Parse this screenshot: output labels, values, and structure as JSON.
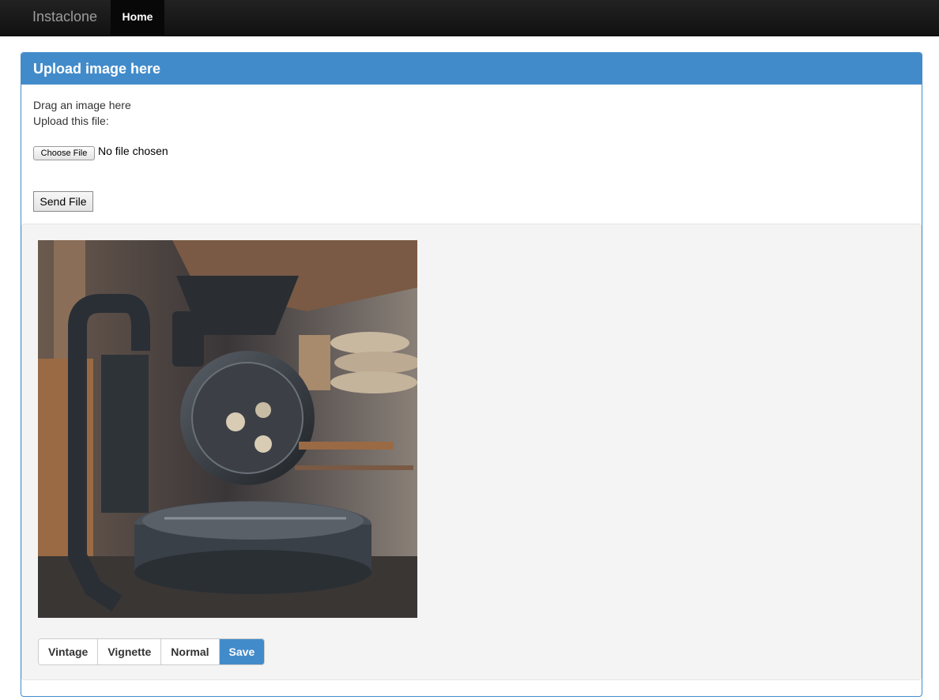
{
  "navbar": {
    "brand": "Instaclone",
    "home_label": "Home"
  },
  "panel": {
    "title": "Upload image here",
    "drag_text": "Drag an image here",
    "upload_text": "Upload this file:",
    "file_input": {
      "button_label": "Choose File",
      "status": "No file chosen"
    },
    "send_label": "Send File"
  },
  "editor": {
    "filters": [
      "Vintage",
      "Vignette",
      "Normal"
    ],
    "save_label": "Save"
  },
  "colors": {
    "primary": "#428bca",
    "navbar": "#222222"
  }
}
